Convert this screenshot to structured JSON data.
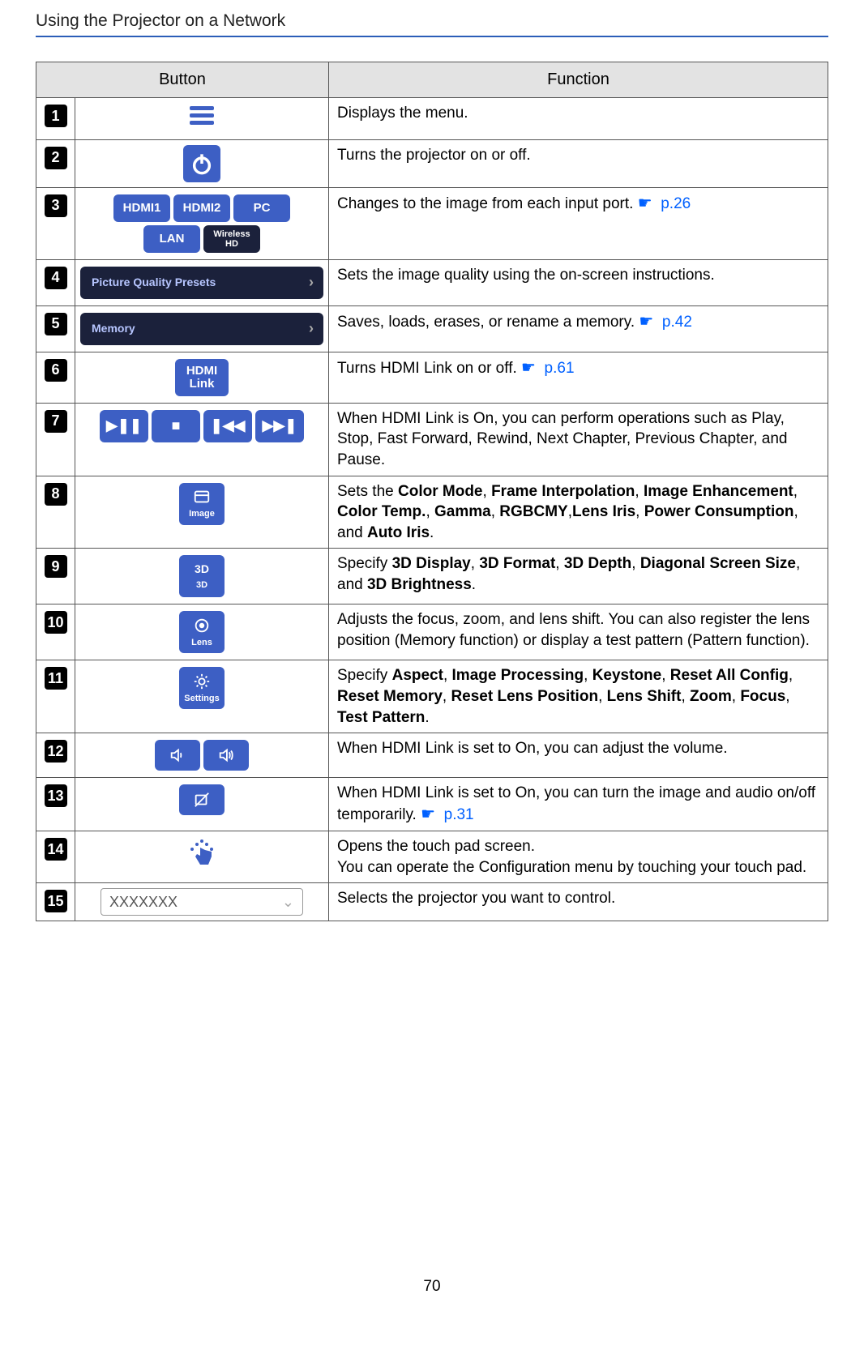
{
  "header": {
    "title": "Using the Projector on a Network"
  },
  "table": {
    "columns": {
      "button": "Button",
      "function": "Function"
    },
    "rows": [
      {
        "num": "1",
        "button": {
          "type": "menu-icon"
        },
        "function": {
          "text": "Displays the menu."
        }
      },
      {
        "num": "2",
        "button": {
          "type": "power"
        },
        "function": {
          "text": "Turns the projector on or off."
        }
      },
      {
        "num": "3",
        "button": {
          "type": "sources",
          "labels": [
            "HDMI1",
            "HDMI2",
            "PC",
            "LAN",
            "Wireless HD"
          ]
        },
        "function": {
          "text": "Changes to the image from each input port. ",
          "link": "p.26"
        }
      },
      {
        "num": "4",
        "button": {
          "type": "wide",
          "label": "Picture Quality Presets"
        },
        "function": {
          "text": "Sets the image quality using the on-screen instructions."
        }
      },
      {
        "num": "5",
        "button": {
          "type": "wide",
          "label": "Memory"
        },
        "function": {
          "text": "Saves, loads, erases, or rename a memory. ",
          "link": "p.42"
        }
      },
      {
        "num": "6",
        "button": {
          "type": "hdmilink",
          "label_top": "HDMI",
          "label_bot": "Link"
        },
        "function": {
          "text": "Turns HDMI Link on or off. ",
          "link": "p.61"
        }
      },
      {
        "num": "7",
        "button": {
          "type": "transport"
        },
        "function": {
          "text": "When HDMI Link is On, you can perform operations such as Play, Stop, Fast Forward, Rewind, Next Chapter, Previous Chapter, and Pause."
        }
      },
      {
        "num": "8",
        "button": {
          "type": "square",
          "label": "Image"
        },
        "function": {
          "html": "Sets the <strong>Color Mode</strong>, <strong>Frame Interpolation</strong>, <strong>Image Enhancement</strong>, <strong>Color Temp.</strong>, <strong>Gamma</strong>, <strong>RGBCMY</strong>,<strong>Lens Iris</strong>, <strong>Power Consumption</strong>, and <strong>Auto Iris</strong>."
        }
      },
      {
        "num": "9",
        "button": {
          "type": "square",
          "label": "3D"
        },
        "function": {
          "html": "Specify <strong>3D Display</strong>, <strong>3D Format</strong>, <strong>3D Depth</strong>, <strong>Diagonal Screen Size</strong>, and <strong>3D Brightness</strong>."
        }
      },
      {
        "num": "10",
        "button": {
          "type": "square",
          "label": "Lens"
        },
        "function": {
          "text": "Adjusts the focus, zoom, and lens shift. You can also register the lens position (Memory function) or display a test pattern (Pattern function)."
        }
      },
      {
        "num": "11",
        "button": {
          "type": "square",
          "label": "Settings"
        },
        "function": {
          "html": "Specify <strong>Aspect</strong>, <strong>Image Processing</strong>, <strong>Keystone</strong>, <strong>Reset All Config</strong>, <strong>Reset Memory</strong>, <strong>Reset Lens Position</strong>, <strong>Lens Shift</strong>, <strong>Zoom</strong>, <strong>Focus</strong>, <strong>Test Pattern</strong>."
        }
      },
      {
        "num": "12",
        "button": {
          "type": "volume"
        },
        "function": {
          "text": "When HDMI Link is set to On, you can adjust the volume."
        }
      },
      {
        "num": "13",
        "button": {
          "type": "avmute"
        },
        "function": {
          "text": "When HDMI Link is set to On, you can turn the image and audio on/off temporarily. ",
          "link": "p.31"
        }
      },
      {
        "num": "14",
        "button": {
          "type": "touch"
        },
        "function": {
          "text_line1": "Opens the touch pad screen.",
          "text_line2": "You can operate the Configuration menu by touching your touch pad."
        }
      },
      {
        "num": "15",
        "button": {
          "type": "dropdown",
          "label": "XXXXXXX"
        },
        "function": {
          "text": "Selects the projector you want to control."
        }
      }
    ]
  },
  "page_number": "70"
}
